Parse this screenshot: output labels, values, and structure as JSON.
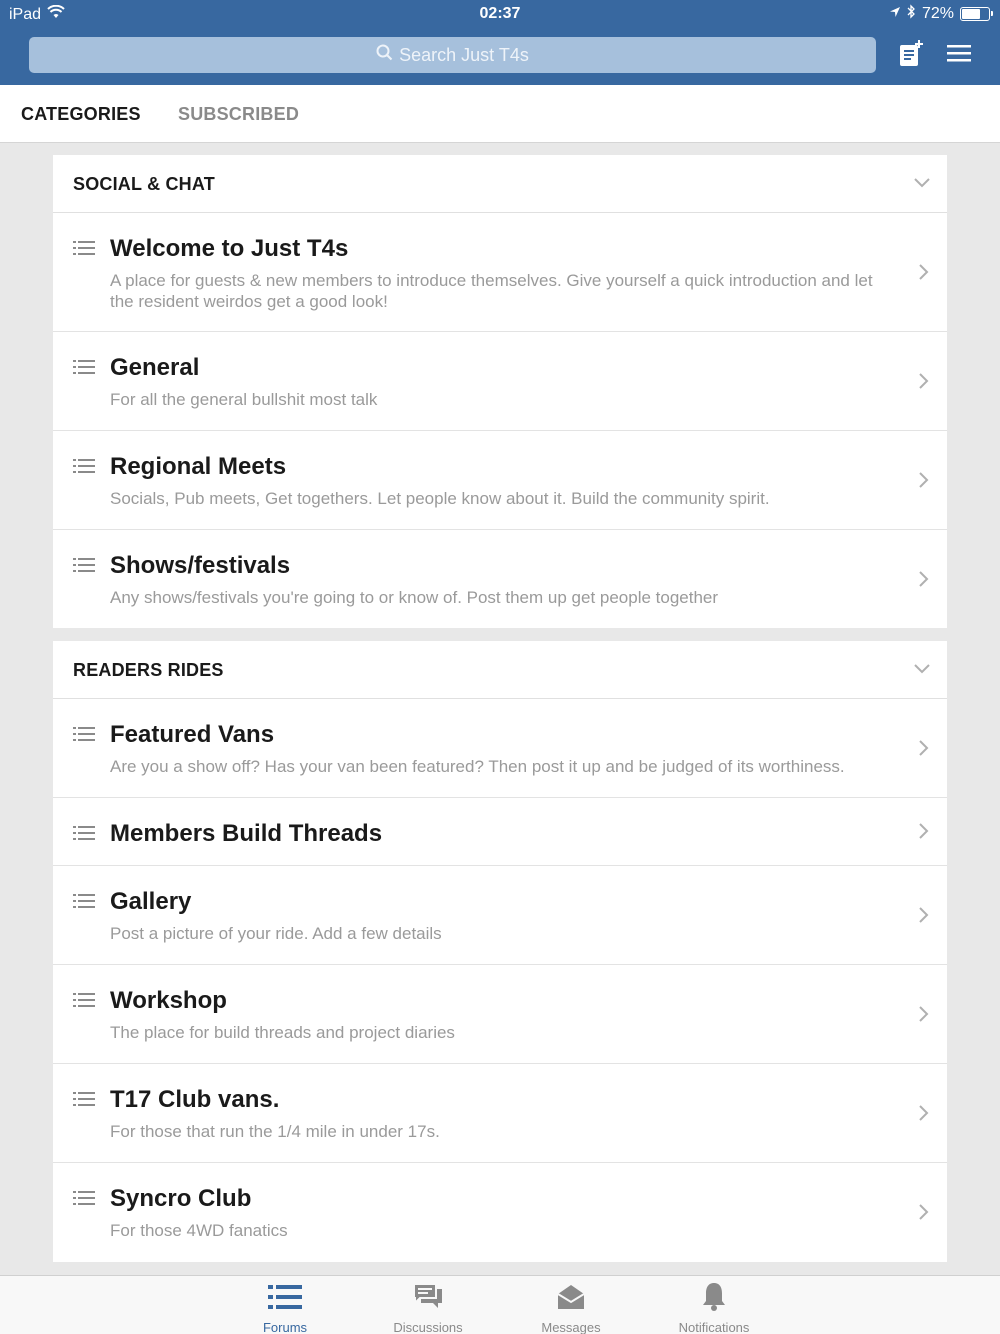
{
  "status": {
    "device": "iPad",
    "time": "02:37",
    "battery_percent": "72%",
    "battery_level": 0.72
  },
  "header": {
    "search_placeholder": "Search Just T4s"
  },
  "tabs": [
    {
      "label": "CATEGORIES",
      "active": true
    },
    {
      "label": "SUBSCRIBED",
      "active": false
    }
  ],
  "sections": [
    {
      "title": "SOCIAL & CHAT",
      "forums": [
        {
          "title": "Welcome to Just T4s",
          "desc": "A place for guests & new members to introduce themselves. Give yourself a quick introduction and let the resident weirdos get a good look!"
        },
        {
          "title": "General",
          "desc": "For all the general bullshit most talk"
        },
        {
          "title": "Regional Meets",
          "desc": "Socials, Pub meets, Get togethers.  Let people know about it.  Build the community spirit."
        },
        {
          "title": "Shows/festivals",
          "desc": "Any shows/festivals you're going to or know of. Post them up get people together"
        }
      ]
    },
    {
      "title": "READERS RIDES",
      "forums": [
        {
          "title": "Featured Vans",
          "desc": "Are you a show off? Has your van been featured? Then post it up and be judged of its worthiness."
        },
        {
          "title": "Members Build Threads",
          "desc": ""
        },
        {
          "title": "Gallery",
          "desc": "Post a picture of your ride.  Add a few details"
        },
        {
          "title": "Workshop",
          "desc": "The place for build threads and project diaries"
        },
        {
          "title": "T17 Club vans.",
          "desc": "For those that run the 1/4 mile in under 17s."
        },
        {
          "title": "Syncro Club",
          "desc": "For those 4WD fanatics"
        }
      ]
    }
  ],
  "bottom_nav": [
    {
      "label": "Forums",
      "icon": "list-icon",
      "active": true
    },
    {
      "label": "Discussions",
      "icon": "chat-bubbles-icon",
      "active": false
    },
    {
      "label": "Messages",
      "icon": "envelope-open-icon",
      "active": false
    },
    {
      "label": "Notifications",
      "icon": "bell-icon",
      "active": false
    }
  ],
  "colors": {
    "header_bg": "#3868a0",
    "accent": "#3868a0",
    "page_bg": "#e8e8e8"
  }
}
